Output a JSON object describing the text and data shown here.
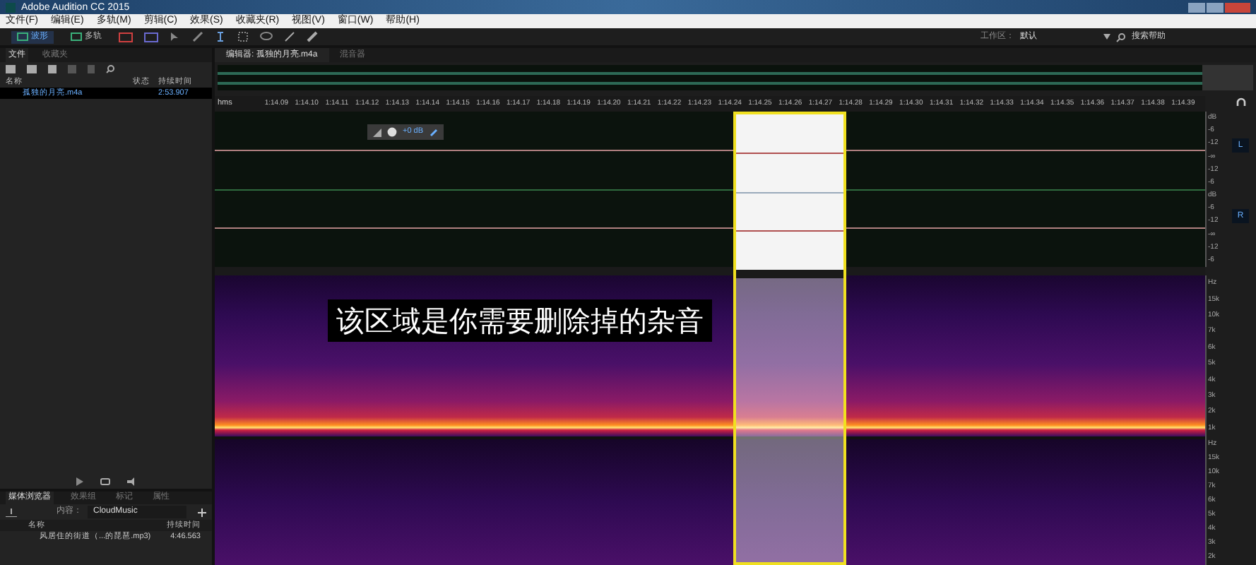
{
  "window": {
    "title": "Adobe Audition CC 2015"
  },
  "menu": [
    "文件(F)",
    "编辑(E)",
    "多轨(M)",
    "剪辑(C)",
    "效果(S)",
    "收藏夹(R)",
    "视图(V)",
    "窗口(W)",
    "帮助(H)"
  ],
  "toolbar": {
    "views": [
      {
        "label": "波形",
        "selected": true
      },
      {
        "label": "多轨",
        "selected": false
      }
    ],
    "workspace_label": "工作区：",
    "workspace": "默认",
    "search": "搜索帮助"
  },
  "files_panel": {
    "tabs": [
      {
        "label": "文件",
        "selected": true
      },
      {
        "label": "收藏夹",
        "selected": false
      }
    ],
    "columns": [
      "名称",
      "状态",
      "持续时间"
    ],
    "rows": [
      {
        "name": "孤独的月亮.m4a",
        "duration": "2:53.907",
        "selected": true
      }
    ]
  },
  "media_browser": {
    "tabs": [
      {
        "label": "媒体浏览器",
        "selected": true
      },
      {
        "label": "效果组",
        "selected": false
      },
      {
        "label": "标记",
        "selected": false
      },
      {
        "label": "属性",
        "selected": false
      }
    ],
    "content_label": "内容：",
    "content": "CloudMusic",
    "columns": [
      "名称",
      "持续时间"
    ],
    "rows": [
      {
        "name": "风居住的街道（...的琵琶.mp3)",
        "duration": "4:46.563"
      }
    ]
  },
  "editor": {
    "tabs": [
      {
        "label": "编辑器: 孤独的月亮.m4a",
        "selected": true
      },
      {
        "label": "混音器",
        "selected": false
      }
    ],
    "hud_gain": "+0 dB",
    "ruler_unit": "hms",
    "ruler_labels": [
      "1:14.09",
      "1:14.10",
      "1:14.11",
      "1:14.12",
      "1:14.13",
      "1:14.14",
      "1:14.15",
      "1:14.16",
      "1:14.17",
      "1:14.18",
      "1:14.19",
      "1:14.20",
      "1:14.21",
      "1:14.22",
      "1:14.23",
      "1:14.24",
      "1:14.25",
      "1:14.26",
      "1:14.27",
      "1:14.28",
      "1:14.29",
      "1:14.30",
      "1:14.31",
      "1:14.32",
      "1:14.33",
      "1:14.34",
      "1:14.35",
      "1:14.36",
      "1:14.37",
      "1:14.38",
      "1:14.39"
    ],
    "annotation": "该区域是你需要删除掉的杂音",
    "db_scales": [
      [
        "dB",
        "-6",
        "-12",
        "-∞",
        "-12",
        "-6"
      ],
      [
        "dB",
        "-6",
        "-12",
        "-∞",
        "-12",
        "-6"
      ]
    ],
    "freq_scales": [
      [
        "Hz",
        "15k",
        "10k",
        "7k",
        "6k",
        "5k",
        "4k",
        "3k",
        "2k",
        "1k"
      ],
      [
        "Hz",
        "15k",
        "10k",
        "7k",
        "6k",
        "5k",
        "4k",
        "3k",
        "2k"
      ]
    ],
    "channel_buttons": [
      "L",
      "R"
    ]
  }
}
